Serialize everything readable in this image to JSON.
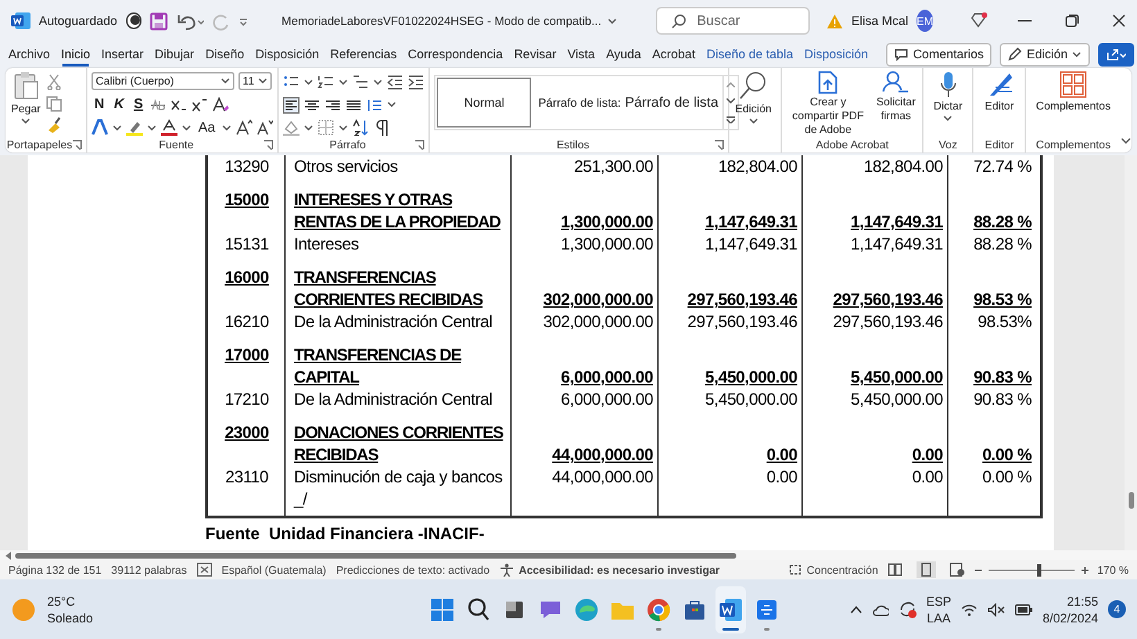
{
  "title_bar": {
    "autosave_label": "Autoguardado",
    "autosave_on": false,
    "document_title": "MemoriadeLaboresVF01022024HSEG  -  Modo de compatib...",
    "search": {
      "placeholder": "Buscar"
    },
    "user_name": "Elisa Mcal",
    "user_initials": "EM"
  },
  "menu_tabs": [
    {
      "label": "Archivo",
      "selected": false,
      "kind": "normal"
    },
    {
      "label": "Inicio",
      "selected": true,
      "kind": "normal"
    },
    {
      "label": "Insertar",
      "selected": false,
      "kind": "normal"
    },
    {
      "label": "Dibujar",
      "selected": false,
      "kind": "normal"
    },
    {
      "label": "Diseño",
      "selected": false,
      "kind": "normal"
    },
    {
      "label": "Disposición",
      "selected": false,
      "kind": "normal"
    },
    {
      "label": "Referencias",
      "selected": false,
      "kind": "normal"
    },
    {
      "label": "Correspondencia",
      "selected": false,
      "kind": "normal"
    },
    {
      "label": "Revisar",
      "selected": false,
      "kind": "normal"
    },
    {
      "label": "Vista",
      "selected": false,
      "kind": "normal"
    },
    {
      "label": "Ayuda",
      "selected": false,
      "kind": "normal"
    },
    {
      "label": "Acrobat",
      "selected": false,
      "kind": "normal"
    },
    {
      "label": "Diseño de tabla",
      "selected": false,
      "kind": "contextual"
    },
    {
      "label": "Disposición",
      "selected": false,
      "kind": "contextual"
    }
  ],
  "ribbon_buttons": [
    "Comentarios",
    "Edición"
  ],
  "ribbon": {
    "clipboard": {
      "paste_label": "Pegar",
      "group_label": "Portapapeles"
    },
    "font": {
      "font_name": "Calibri (Cuerpo)",
      "font_size": "11",
      "text_buttons": [
        "N",
        "K",
        "S"
      ],
      "case_button": "Aa",
      "group_label": "Fuente"
    },
    "paragraph": {
      "group_label": "Párrafo"
    },
    "styles": {
      "items": [
        "Normal",
        "Párrafo de lista:",
        "Párrafo de lista"
      ],
      "group_label": "Estilos"
    },
    "editing": {
      "label": "Edición"
    },
    "acrobat": {
      "buttons": [
        "Crear y compartir PDF de Adobe",
        "Solicitar firmas"
      ],
      "group_label": "Adobe Acrobat"
    },
    "voice": {
      "button": "Dictar",
      "group_label": "Voz"
    },
    "editor": {
      "button": "Editor",
      "group_label": "Editor"
    },
    "addins": {
      "button": "Complementos",
      "group_label": "Complementos"
    }
  },
  "table": {
    "rows": [
      {
        "kind": "detail",
        "cells": [
          "13290",
          "Otros servicios",
          "251,300.00",
          "182,804.00",
          "182,804.00",
          "72.74 %"
        ]
      },
      {
        "kind": "heading",
        "cells": [
          "15000",
          "INTERESES Y OTRAS RENTAS DE LA PROPIEDAD",
          "1,300,000.00",
          "1,147,649.31",
          "1,147,649.31",
          "88.28 %"
        ]
      },
      {
        "kind": "detail",
        "cells": [
          "15131",
          "Intereses",
          "1,300,000.00",
          "1,147,649.31",
          "1,147,649.31",
          "88.28 %"
        ]
      },
      {
        "kind": "heading",
        "cells": [
          "16000",
          "TRANSFERENCIAS CORRIENTES RECIBIDAS",
          "302,000,000.00",
          "297,560,193.46",
          "297,560,193.46",
          "98.53 %"
        ]
      },
      {
        "kind": "detail",
        "cells": [
          "16210",
          "De la Administración Central",
          "302,000,000.00",
          "297,560,193.46",
          "297,560,193.46",
          "98.53%"
        ]
      },
      {
        "kind": "heading",
        "cells": [
          "17000",
          "TRANSFERENCIAS DE CAPITAL",
          "6,000,000.00",
          "5,450,000.00",
          "5,450,000.00",
          "90.83 %"
        ]
      },
      {
        "kind": "detail",
        "cells": [
          "17210",
          "De la Administración Central",
          "6,000,000.00",
          "5,450,000.00",
          "5,450,000.00",
          "90.83 %"
        ]
      },
      {
        "kind": "heading",
        "cells": [
          "23000",
          "DONACIONES CORRIENTES RECIBIDAS",
          "44,000,000.00",
          "0.00",
          "0.00",
          "0.00 %"
        ]
      },
      {
        "kind": "detail",
        "cells": [
          "23110",
          "Disminución de caja y bancos _/",
          "44,000,000.00",
          "0.00",
          "0.00",
          "0.00 %"
        ]
      }
    ]
  },
  "footnote": "Fuente  Unidad Financiera -INACIF-",
  "status_bar": {
    "page": "Página 132 de 151",
    "words": "39112 palabras",
    "language": "Español (Guatemala)",
    "predictions": "Predicciones de texto: activado",
    "accessibility": "Accesibilidad: es necesario investigar",
    "focus": "Concentración",
    "zoom": {
      "level": 0.59,
      "reading": "170 %"
    }
  },
  "taskbar": {
    "weather": {
      "temperature": "25°C",
      "condition": "Soleado"
    },
    "apps": [
      {
        "kind": "start",
        "running": false,
        "selected": false
      },
      {
        "kind": "search",
        "running": false,
        "selected": false
      },
      {
        "kind": "taskview",
        "running": false,
        "selected": false
      },
      {
        "kind": "chat",
        "running": false,
        "selected": false
      },
      {
        "kind": "edge",
        "running": false,
        "selected": false
      },
      {
        "kind": "explorer",
        "running": false,
        "selected": false
      },
      {
        "kind": "chrome",
        "running": true,
        "selected": false
      },
      {
        "kind": "store",
        "running": false,
        "selected": false
      },
      {
        "kind": "word",
        "running": true,
        "selected": true
      },
      {
        "kind": "automate",
        "running": true,
        "selected": false
      }
    ],
    "tray": {
      "language": "ESP",
      "layout": "LAA",
      "time": "21:55",
      "date": "8/02/2024",
      "notifications": "4"
    }
  }
}
